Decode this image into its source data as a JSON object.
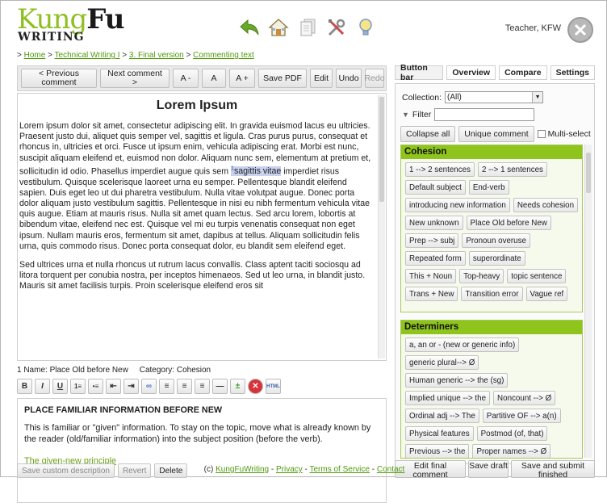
{
  "logo": {
    "kung": "Kung",
    "fu": "Fu",
    "sub": "WRITING"
  },
  "breadcrumb": {
    "sep": ">",
    "items": [
      "Home",
      "Technical Writing I",
      "3. Final version",
      "Commenting text"
    ]
  },
  "user": {
    "name": "Teacher, KFW"
  },
  "toolbar": {
    "prev": "< Previous comment",
    "next": "Next comment >",
    "a_minus": "A -",
    "a": "A",
    "a_plus": "A +",
    "save_pdf": "Save PDF",
    "edit": "Edit",
    "undo": "Undo",
    "redo": "Redo"
  },
  "document": {
    "title": "Lorem Ipsum",
    "p1_before": "Lorem ipsum dolor sit amet, consectetur adipiscing elit. In gravida euismod lacus eu ultricies. Praesent justo dui, aliquet quis semper vel, sagittis et ligula. Cras purus purus, consequat et rhoncus in, ultricies et orci. Fusce ut ipsum enim, vehicula adipiscing erat. Morbi est nunc, suscipit aliquam eleifend et, euismod non dolor. Aliquam nunc sem, elementum at pretium et, sollicitudin id odio. Phasellus imperdiet augue quis sem ",
    "marker": "1",
    "highlight": "sagittis vitae",
    "p1_after": " imperdiet risus vestibulum. Quisque scelerisque laoreet urna eu semper. Pellentesque blandit eleifend sapien. Duis eget leo ut dui pharetra vestibulum. Nulla vitae volutpat augue. Donec porta dolor aliquam justo vestibulum sagittis. Pellentesque in nisi eu nibh fermentum vehicula vitae quis augue. Etiam at mauris risus. Nulla sit amet quam lectus. Sed arcu lorem, lobortis at bibendum vitae, eleifend nec est. Quisque vel mi eu turpis venenatis consequat non eget ipsum. Nullam mauris eros, fermentum sit amet, dapibus at tellus. Aliquam sollicitudin felis urna, quis commodo risus. Donec porta consequat dolor, eu blandit sem eleifend eget.",
    "p2": "Sed ultrices urna et nulla rhoncus ut rutrum lacus convallis. Class aptent taciti sociosqu ad litora torquent per conubia nostra, per inceptos himenaeos. Sed ut leo urna, in blandit justo. Mauris sit amet facilisis turpis. Proin scelerisque eleifend eros sit"
  },
  "comment": {
    "meta": "1 Name: Place Old before New     Category: Cohesion"
  },
  "format_buttons": [
    "B",
    "I",
    "U",
    "1≡",
    "•≡",
    "⇤",
    "⇥",
    "∞",
    "≡",
    "≡",
    "≡",
    "—",
    "±",
    "✕",
    "HTML"
  ],
  "description": {
    "title": "PLACE FAMILIAR INFORMATION BEFORE NEW",
    "text": "This is familiar or \"given\" information. To stay on the topic, move what is already known by the reader (old/familiar information) into the subject position (before the verb).",
    "link": "The given-new principle"
  },
  "left_buttons": {
    "save_custom": "Save custom description",
    "revert": "Revert",
    "delete": "Delete"
  },
  "tabs": [
    "Button bar",
    "Overview",
    "Compare",
    "Settings"
  ],
  "panel": {
    "collection_label": "Collection:",
    "collection_value": "(All)",
    "filter_label": "Filter",
    "collapse_all": "Collapse all",
    "unique_comment": "Unique comment",
    "multi_select": "Multi-select"
  },
  "categories": [
    {
      "name": "Cohesion",
      "chips": [
        "1 --> 2 sentences",
        "2 --> 1 sentences",
        "Default subject",
        "End-verb",
        "introducing new information",
        "Needs cohesion",
        "New unknown",
        "Place Old before New",
        "Prep --> subj",
        "Pronoun overuse",
        "Repeated form",
        "superordinate",
        "This + Noun",
        "Top-heavy",
        "topic sentence",
        "Trans + New",
        "Transition error",
        "Vague ref"
      ]
    },
    {
      "name": "Determiners",
      "chips": [
        "a, an or - (new or generic info)",
        "generic plural--> Ø",
        "Human generic --> the (sg)",
        "Implied unique --> the",
        "Noncount --> Ø",
        "Ordinal adj --> The",
        "Partitive OF --> a(n)",
        "Physical features",
        "Postmod (of, that)",
        "Previous --> the",
        "Proper names --> Ø"
      ]
    }
  ],
  "right_buttons": {
    "edit_final": "Edit final comment",
    "save_draft": "Save draft",
    "save_submit": "Save and submit finished"
  },
  "footer": {
    "prefix": "(c) ",
    "brand": "KungFuWriting",
    "sep": " - ",
    "privacy": "Privacy",
    "terms": "Terms of Service",
    "contact": "Contact"
  }
}
